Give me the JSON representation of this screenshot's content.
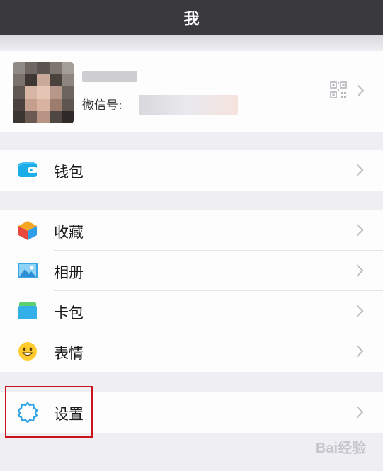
{
  "header": {
    "title": "我"
  },
  "profile": {
    "wechat_id_label": "微信号:",
    "icon": "qr-code-icon"
  },
  "wallet_section": {
    "items": [
      {
        "label": "钱包",
        "icon": "wallet-icon",
        "color": "#1aade8"
      }
    ]
  },
  "tools_section": {
    "items": [
      {
        "label": "收藏",
        "icon": "favorites-cube-icon",
        "color": "#f5a623"
      },
      {
        "label": "相册",
        "icon": "album-icon",
        "color": "#3aa6e8"
      },
      {
        "label": "卡包",
        "icon": "card-pack-icon",
        "color": "#33b0e8"
      },
      {
        "label": "表情",
        "icon": "sticker-smiley-icon",
        "color": "#ffcb2e"
      }
    ]
  },
  "settings_section": {
    "items": [
      {
        "label": "设置",
        "icon": "settings-gear-icon",
        "color": "#2ea3e8"
      }
    ]
  },
  "highlight_color": "#c8151d",
  "watermark": {
    "text": "Bai经验"
  }
}
